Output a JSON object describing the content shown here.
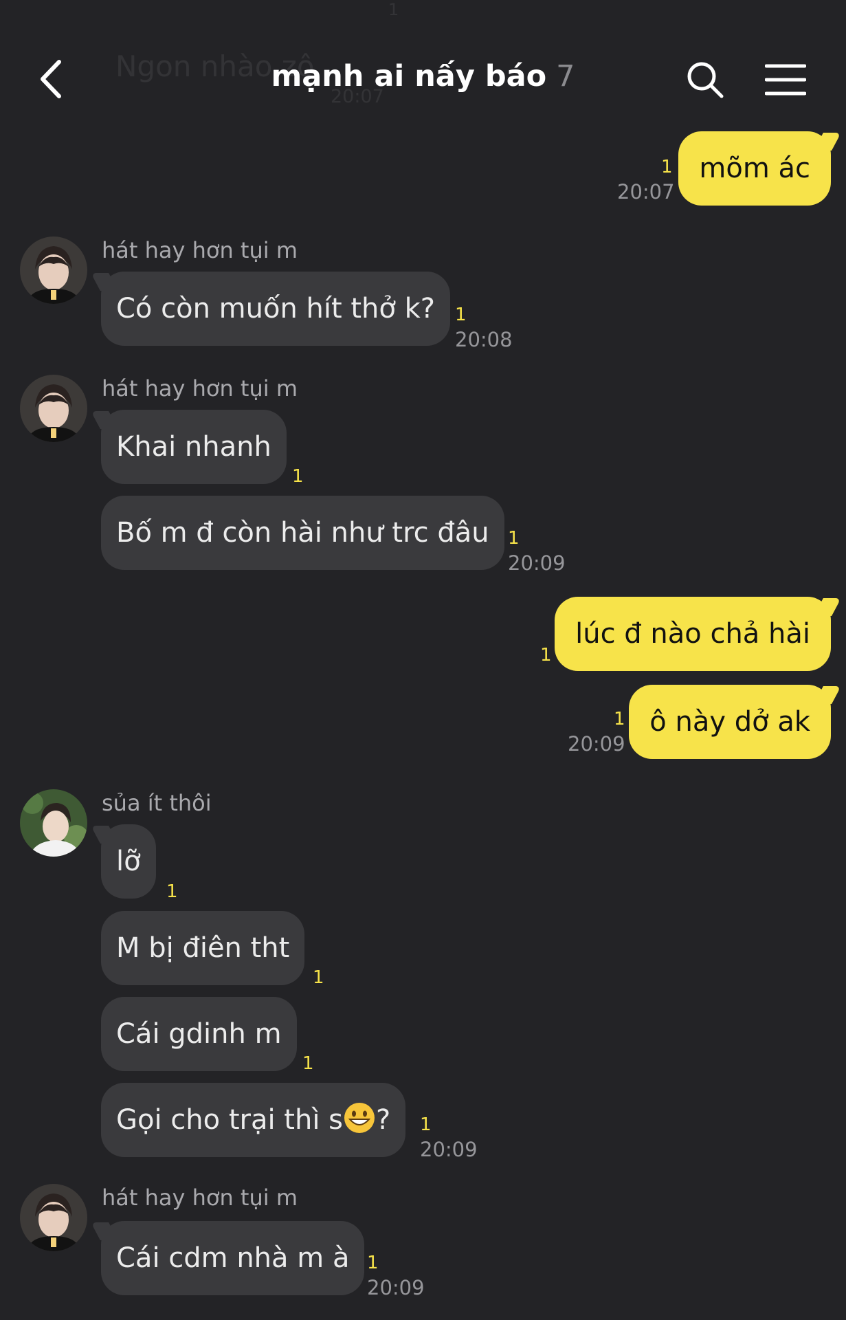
{
  "background_text": {
    "preview": "Ngon nhào zô",
    "time": "20:07",
    "unread": "1"
  },
  "header": {
    "title": "mạnh ai nấy báo",
    "member_count": "7"
  },
  "messages": [
    {
      "text": "mõm ác",
      "unread": "1",
      "time": "20:07"
    },
    {
      "sender": "hát hay hơn tụi m",
      "text": "Có còn muốn hít thở k?",
      "unread": "1",
      "time": "20:08"
    },
    {
      "sender": "hát hay hơn tụi m",
      "text": "Khai nhanh",
      "unread": "1"
    },
    {
      "text": "Bố m đ còn hài như trc đâu",
      "unread": "1",
      "time": "20:09"
    },
    {
      "text": "lúc đ nào chả hài",
      "unread": "1"
    },
    {
      "text": "ô này dở ak",
      "unread": "1",
      "time": "20:09"
    },
    {
      "sender": "sủa ít thôi",
      "text": "lỡ",
      "unread": "1"
    },
    {
      "text": "M bị điên tht",
      "unread": "1"
    },
    {
      "text": "Cái gdinh m",
      "unread": "1"
    },
    {
      "text_before": "Gọi cho trại thì s",
      "emoji": "grinning-face-emoji",
      "text_after": "?",
      "unread": "1",
      "time": "20:09"
    },
    {
      "sender": "hát hay hơn tụi m",
      "text": "Cái cdm nhà m à",
      "unread": "1",
      "time": "20:09"
    }
  ],
  "colors": {
    "background": "#232326",
    "outgoing_bubble": "#f7e34a",
    "incoming_bubble": "#3a3a3d",
    "unread": "#f7e34a"
  }
}
